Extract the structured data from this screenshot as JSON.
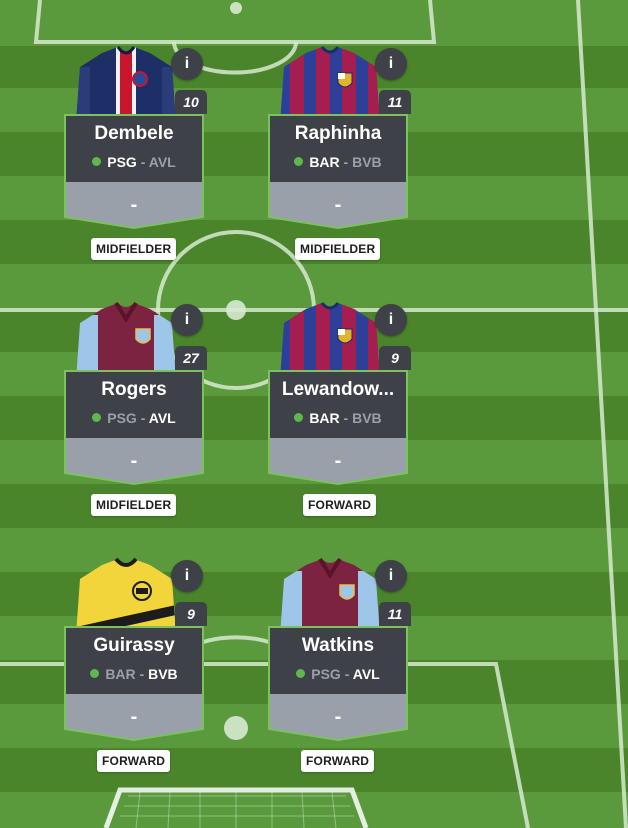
{
  "colors": {
    "pitch_dark": "#4a852b",
    "pitch_light": "#58963a",
    "card_top": "#3e4148",
    "card_bottom": "#9aa0aa",
    "card_border": "#7bc25f",
    "status_dot": "#5fb84e"
  },
  "players": [
    {
      "name": "Dembele",
      "number": "10",
      "info": "i",
      "team": "PSG",
      "sep": "-",
      "opponent": "AVL",
      "score": "-",
      "position": "MIDFIELDER",
      "shirt": "psg-shirt-icon"
    },
    {
      "name": "Raphinha",
      "number": "11",
      "info": "i",
      "team": "BAR",
      "sep": "-",
      "opponent": "BVB",
      "score": "-",
      "position": "MIDFIELDER",
      "shirt": "barcelona-shirt-icon"
    },
    {
      "name": "Rogers",
      "number": "27",
      "info": "i",
      "team": "PSG",
      "sep": "-",
      "opponent": "AVL",
      "score": "-",
      "position": "MIDFIELDER",
      "shirt": "aston-villa-shirt-icon"
    },
    {
      "name": "Lewandow...",
      "number": "9",
      "info": "i",
      "team": "BAR",
      "sep": "-",
      "opponent": "BVB",
      "score": "-",
      "position": "FORWARD",
      "shirt": "barcelona-shirt-icon"
    },
    {
      "name": "Guirassy",
      "number": "9",
      "info": "i",
      "team": "BAR",
      "sep": "-",
      "opponent": "BVB",
      "score": "-",
      "position": "FORWARD",
      "shirt": "dortmund-shirt-icon"
    },
    {
      "name": "Watkins",
      "number": "11",
      "info": "i",
      "team": "PSG",
      "sep": "-",
      "opponent": "AVL",
      "score": "-",
      "position": "FORWARD",
      "shirt": "aston-villa-shirt-icon"
    }
  ]
}
